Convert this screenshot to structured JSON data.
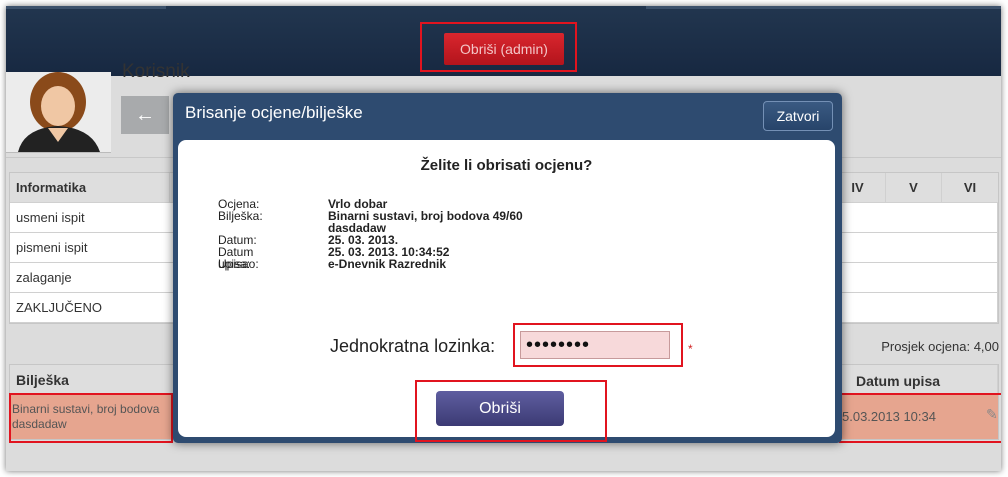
{
  "header": {
    "admin_delete_label": "Obriši (admin)"
  },
  "user": {
    "name": "Korisnik"
  },
  "grades_table": {
    "subject": "Informatika",
    "rows": [
      "usmeni ispit",
      "pismeni ispit",
      "zalaganje",
      "ZAKLJUČENO"
    ],
    "columns": [
      "IV",
      "V",
      "VI"
    ],
    "average": "Prosjek ocjena: 4,00"
  },
  "notes_table": {
    "header_note": "Bilješka",
    "header_date": "Datum upisa",
    "row_text_1": "Binarni sustavi, broj bodova",
    "row_text_2": "dasdadaw",
    "row_date": "5.03.2013 10:34"
  },
  "modal": {
    "title": "Brisanje ocjene/bilješke",
    "close_label": "Zatvori",
    "question": "Želite li obrisati ocjenu?",
    "details": {
      "grade_label": "Ocjena:",
      "grade_value": "Vrlo dobar",
      "note_label": "Bilješka:",
      "note_value_1": "Binarni sustavi, broj bodova 49/60",
      "note_value_2": "dasdadaw",
      "date_label": "Datum:",
      "date_value": "25. 03. 2013.",
      "entry_date_label": "Datum upisa:",
      "entry_date_value": "25. 03. 2013. 10:34:52",
      "author_label": "Upisao:",
      "author_value": "e-Dnevnik Razrednik"
    },
    "password_label": "Jednokratna lozinka:",
    "password_value": "••••••••",
    "required_mark": "*",
    "delete_label": "Obriši"
  },
  "icons": {
    "back": "arrow-left-icon",
    "edit": "pencil-icon"
  },
  "colors": {
    "header_bg": "#1d2f47",
    "admin_button": "#c41a22",
    "modal_header": "#2e4b70",
    "delete_button": "#4a4985",
    "highlight": "#e1141f"
  }
}
